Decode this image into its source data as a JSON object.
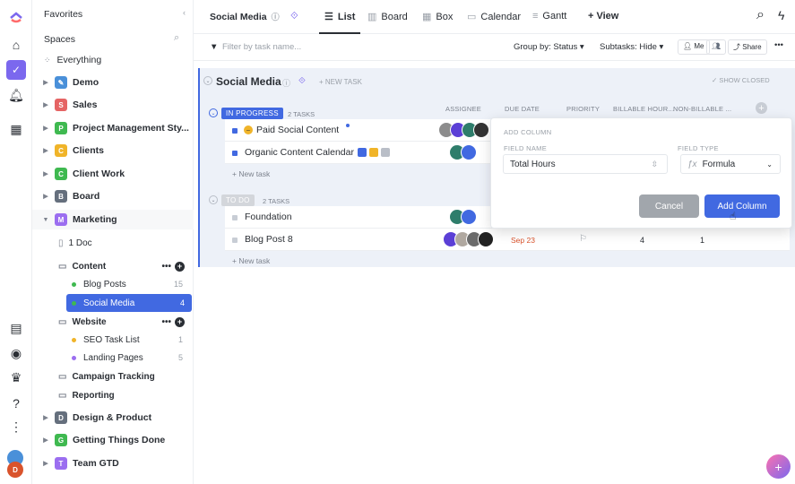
{
  "rail": {
    "icons": [
      "clickup-logo-icon",
      "home-icon",
      "tasks-icon",
      "notifications-icon",
      "dashboard-icon",
      "docs-icon",
      "pulse-icon",
      "goals-icon",
      "help-icon",
      "more-icon"
    ],
    "user_initial": "D"
  },
  "sidebar": {
    "favorites": "Favorites",
    "spaces": "Spaces",
    "everything": "Everything",
    "items": [
      {
        "letter": "",
        "label": "Demo",
        "color": "#4a90d9"
      },
      {
        "letter": "S",
        "label": "Sales",
        "color": "#e56464"
      },
      {
        "letter": "P",
        "label": "Project Management Sty...",
        "color": "#3fb950"
      },
      {
        "letter": "C",
        "label": "Clients",
        "color": "#f0b429"
      },
      {
        "letter": "C",
        "label": "Client Work",
        "color": "#3fb950"
      },
      {
        "letter": "B",
        "label": "Board",
        "color": "#656f7d"
      },
      {
        "letter": "M",
        "label": "Marketing",
        "color": "#9b6ef0"
      }
    ],
    "doc": "1 Doc",
    "content_folder": "Content",
    "blog_posts": {
      "label": "Blog Posts",
      "count": "15"
    },
    "social_media": {
      "label": "Social Media",
      "count": "4"
    },
    "website_folder": "Website",
    "seo": {
      "label": "SEO Task List",
      "count": "1"
    },
    "landing": {
      "label": "Landing Pages",
      "count": "5"
    },
    "campaign": "Campaign Tracking",
    "reporting": "Reporting",
    "spaces_after": [
      {
        "letter": "D",
        "label": "Design & Product",
        "color": "#656f7d"
      },
      {
        "letter": "G",
        "label": "Getting Things Done",
        "color": "#3fb950"
      },
      {
        "letter": "T",
        "label": "Team GTD",
        "color": "#9b6ef0"
      }
    ]
  },
  "topbar": {
    "breadcrumb": "Social Media",
    "views": [
      "List",
      "Board",
      "Box",
      "Calendar",
      "Gantt"
    ],
    "add_view": "+ View"
  },
  "filterbar": {
    "filter_placeholder": "Filter by task name...",
    "group_by": "Group by: Status",
    "subtasks": "Subtasks: Hide",
    "me": "Me",
    "share": "Share"
  },
  "list": {
    "title": "Social Media",
    "new_task_header": "+ NEW TASK",
    "show_closed": "SHOW CLOSED",
    "columns": [
      "ASSIGNEE",
      "DUE DATE",
      "PRIORITY",
      "BILLABLE HOUR...",
      "NON-BILLABLE ..."
    ],
    "groups": [
      {
        "status": "IN PROGRESS",
        "color": "#4169e1",
        "count": "2 TASKS",
        "tasks": [
          {
            "name": "Paid Social Content"
          },
          {
            "name": "Organic Content Calendar"
          }
        ]
      },
      {
        "status": "TO DO",
        "color": "#d3d6db",
        "count": "2 TASKS",
        "tasks": [
          {
            "name": "Foundation"
          },
          {
            "name": "Blog Post 8",
            "due": "Sep 23",
            "billable": "4",
            "non_billable": "1"
          }
        ]
      }
    ],
    "new_task": "+ New task"
  },
  "popup": {
    "title": "ADD COLUMN",
    "field_name_label": "FIELD NAME",
    "field_name_value": "Total Hours",
    "field_type_label": "FIELD TYPE",
    "field_type_value": "Formula",
    "cancel": "Cancel",
    "add": "Add Column"
  }
}
